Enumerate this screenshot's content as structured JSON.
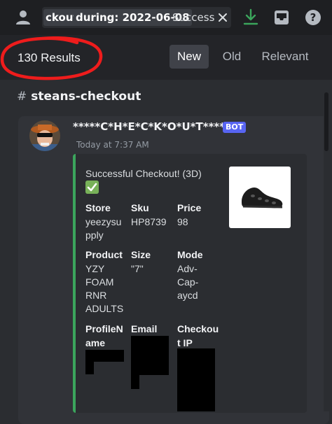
{
  "search": {
    "chip_channel": "ckout",
    "chip_during": "during: 2022-06-08",
    "query_text": "Success"
  },
  "results": {
    "count_label": "130 Results",
    "sort_tabs": [
      "New",
      "Old",
      "Relevant"
    ]
  },
  "channel": {
    "hash": "#",
    "name": "steans-checkout"
  },
  "message": {
    "author": "*****C*H*E*C*K*O*U*T*****",
    "badge": "BOT",
    "timestamp": "Today at 7:37 AM",
    "embed": {
      "accent_color": "#3ba55c",
      "title": "Successful Checkout! (3D)",
      "fields": {
        "store": {
          "name": "Store",
          "value_line1": "yeezysu",
          "value_line2": "pply"
        },
        "sku": {
          "name": "Sku",
          "value": "HP8739"
        },
        "price": {
          "name": "Price",
          "value": "98"
        },
        "product": {
          "name": "Product",
          "value_lines": [
            "YZY",
            "FOAM",
            "RNR",
            "ADULTS"
          ]
        },
        "size": {
          "name": "Size",
          "value": "\"7\""
        },
        "mode": {
          "name": "Mode",
          "value_lines": [
            "Adv-",
            "Cap-",
            "aycd"
          ]
        },
        "profile": {
          "name_line1": "ProfileN",
          "name_line2": "ame"
        },
        "email": {
          "name": "Email"
        },
        "checkout_ip": {
          "name_line1": "Checkou",
          "name_line2": "t IP"
        }
      }
    }
  },
  "icons": [
    "members-icon",
    "clear-icon",
    "download-icon",
    "inbox-icon",
    "help-icon",
    "check-emoji",
    "shoe-thumbnail"
  ]
}
